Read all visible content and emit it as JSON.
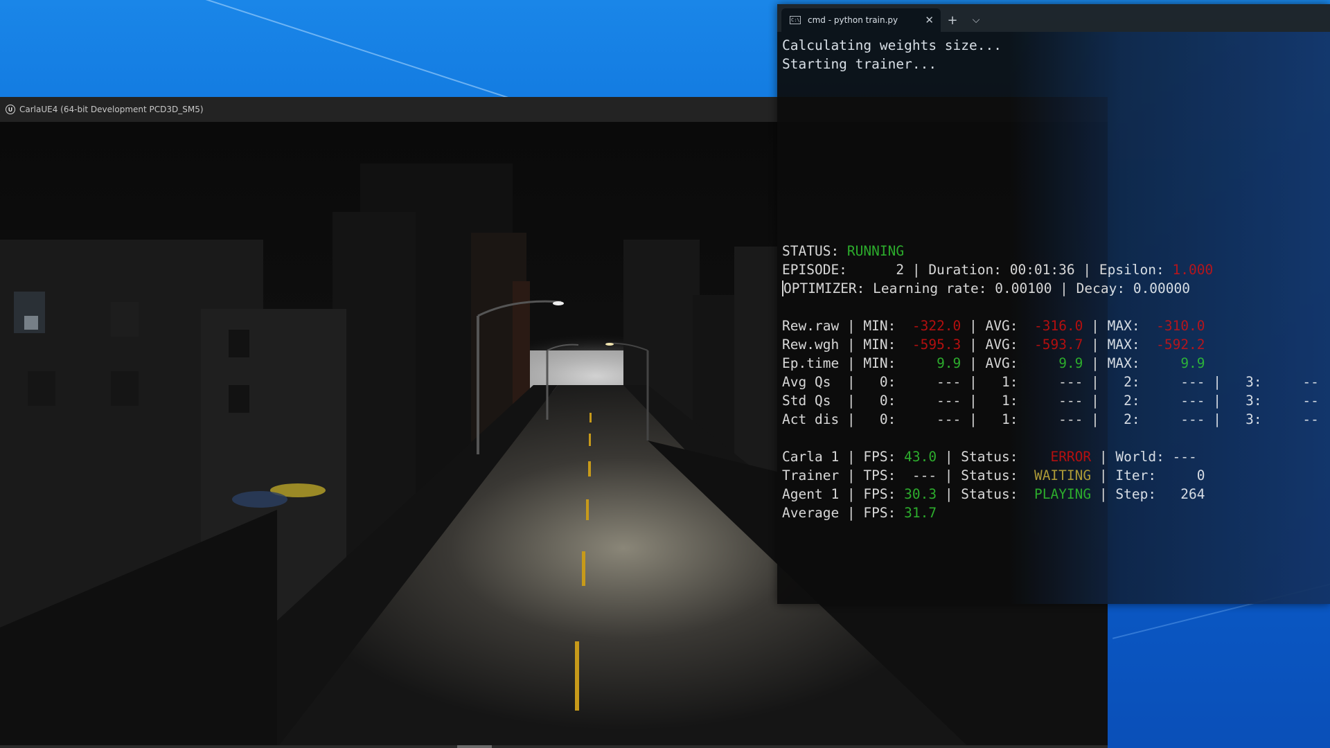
{
  "colors": {
    "desktop": "#0b62d6",
    "terminal_bg": "#0c0c0c",
    "green": "#2fb82f",
    "red": "#c01010",
    "yellow": "#b8a43a"
  },
  "carla": {
    "title": "CarlaUE4 (64-bit Development PCD3D_SM5)",
    "icon": "unreal-engine-icon"
  },
  "terminal": {
    "tab_title": "cmd - python  train.py",
    "tab_icon": "cmd-icon",
    "new_tab": "+",
    "dropdown": "⌵",
    "close": "✕",
    "lines": {
      "l1": "Calculating weights size...",
      "l2": "Starting trainer...",
      "status_label": "STATUS: ",
      "status_value": "RUNNING",
      "episode_prefix": "EPISODE:      2 | Duration: 00:01:36 | Epsilon: ",
      "epsilon_value": "1.000",
      "optimizer_first": "O",
      "optimizer_rest": "PTIMIZER: Learning rate: 0.00100 | Decay: 0.00000",
      "rewraw": [
        "Rew.raw | MIN:  ",
        "-322.0",
        " | AVG:  ",
        "-316.0",
        " | MAX:  ",
        "-310.0"
      ],
      "rewwgh": [
        "Rew.wgh | MIN:  ",
        "-595.3",
        " | AVG:  ",
        "-593.7",
        " | MAX:  ",
        "-592.2"
      ],
      "eptime": [
        "Ep.time | MIN:  ",
        "   9.9",
        " | AVG:  ",
        "   9.9",
        " | MAX:  ",
        "   9.9"
      ],
      "avgqs": "Avg Qs  |   0:     --- |   1:     --- |   2:     --- |   3:     --",
      "stdqs": "Std Qs  |   0:     --- |   1:     --- |   2:     --- |   3:     --",
      "actdis": "Act dis |   0:     --- |   1:     --- |   2:     --- |   3:     --",
      "carla": [
        "Carla 1 | FPS: ",
        "43.0",
        " | Status:    ",
        "ERROR",
        " | World: ---"
      ],
      "trainer": [
        "Trainer | TPS:  --- | Status:  ",
        "WAITING",
        " | Iter:     0"
      ],
      "agent": [
        "Agent 1 | FPS: ",
        "30.3",
        " | Status:  ",
        "PLAYING",
        " | Step:   264"
      ],
      "average": [
        "Average | FPS: ",
        "31.7"
      ]
    }
  }
}
